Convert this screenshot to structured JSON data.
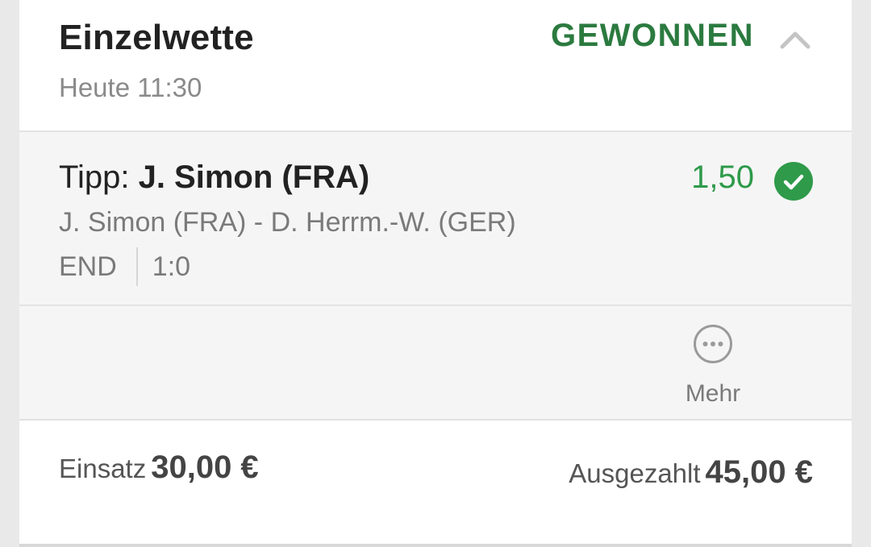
{
  "bet": {
    "type": "Einzelwette",
    "time": "Heute 11:30",
    "status": "GEWONNEN",
    "collapse_icon": "chevron-up-icon"
  },
  "selection": {
    "tip_prefix": "Tipp:",
    "tip_pick": "J. Simon (FRA)",
    "odds": "1,50",
    "won_icon": "check-circle-icon",
    "event": "J. Simon (FRA) - D. Herrm.-W. (GER)",
    "match_status": "END",
    "score": "1:0"
  },
  "actions": {
    "more_label": "Mehr",
    "more_icon": "more-dots-icon"
  },
  "footer": {
    "stake_label": "Einsatz",
    "stake_amount": "30,00 €",
    "payout_label": "Ausgezahlt",
    "payout_amount": "45,00 €"
  },
  "colors": {
    "status_won": "#2b7a3f",
    "odds": "#2e9a4a",
    "check_badge": "#2e9a4a"
  }
}
